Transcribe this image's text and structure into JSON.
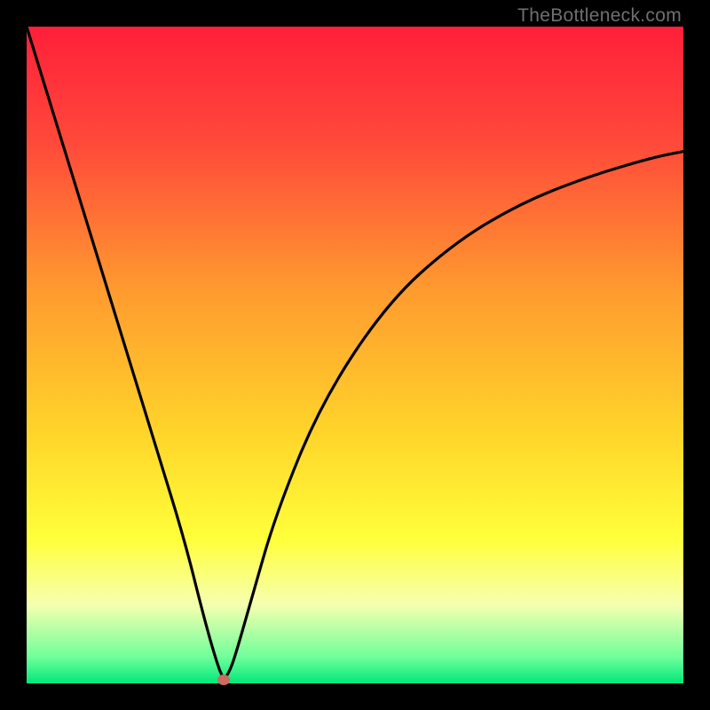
{
  "watermark": "TheBottleneck.com",
  "chart_data": {
    "type": "line",
    "title": "",
    "xlabel": "",
    "ylabel": "",
    "xlim": [
      0,
      100
    ],
    "ylim": [
      0,
      100
    ],
    "gradient_stops": [
      {
        "offset": 0,
        "color": "#ff1f3a"
      },
      {
        "offset": 18,
        "color": "#ff4a3a"
      },
      {
        "offset": 40,
        "color": "#ff9a2f"
      },
      {
        "offset": 62,
        "color": "#ffd52a"
      },
      {
        "offset": 78,
        "color": "#ffff3a"
      },
      {
        "offset": 88,
        "color": "#f6ffb0"
      },
      {
        "offset": 96,
        "color": "#6fff9a"
      },
      {
        "offset": 100,
        "color": "#00e87a"
      }
    ],
    "series": [
      {
        "name": "bottleneck-curve",
        "x": [
          0,
          4,
          8,
          12,
          16,
          20,
          24,
          27,
          29,
          30,
          31,
          32,
          34,
          38,
          45,
          55,
          65,
          75,
          85,
          95,
          100
        ],
        "values": [
          100,
          87,
          74,
          61,
          48,
          35,
          22,
          10,
          3,
          0.5,
          2,
          5,
          12,
          26,
          43,
          58,
          67,
          73,
          77,
          80,
          81
        ]
      }
    ],
    "minimum_marker": {
      "x": 30,
      "y": 0.5
    },
    "colors": {
      "curve": "#000000",
      "marker": "#cf6a5e",
      "background": "#000000"
    }
  }
}
